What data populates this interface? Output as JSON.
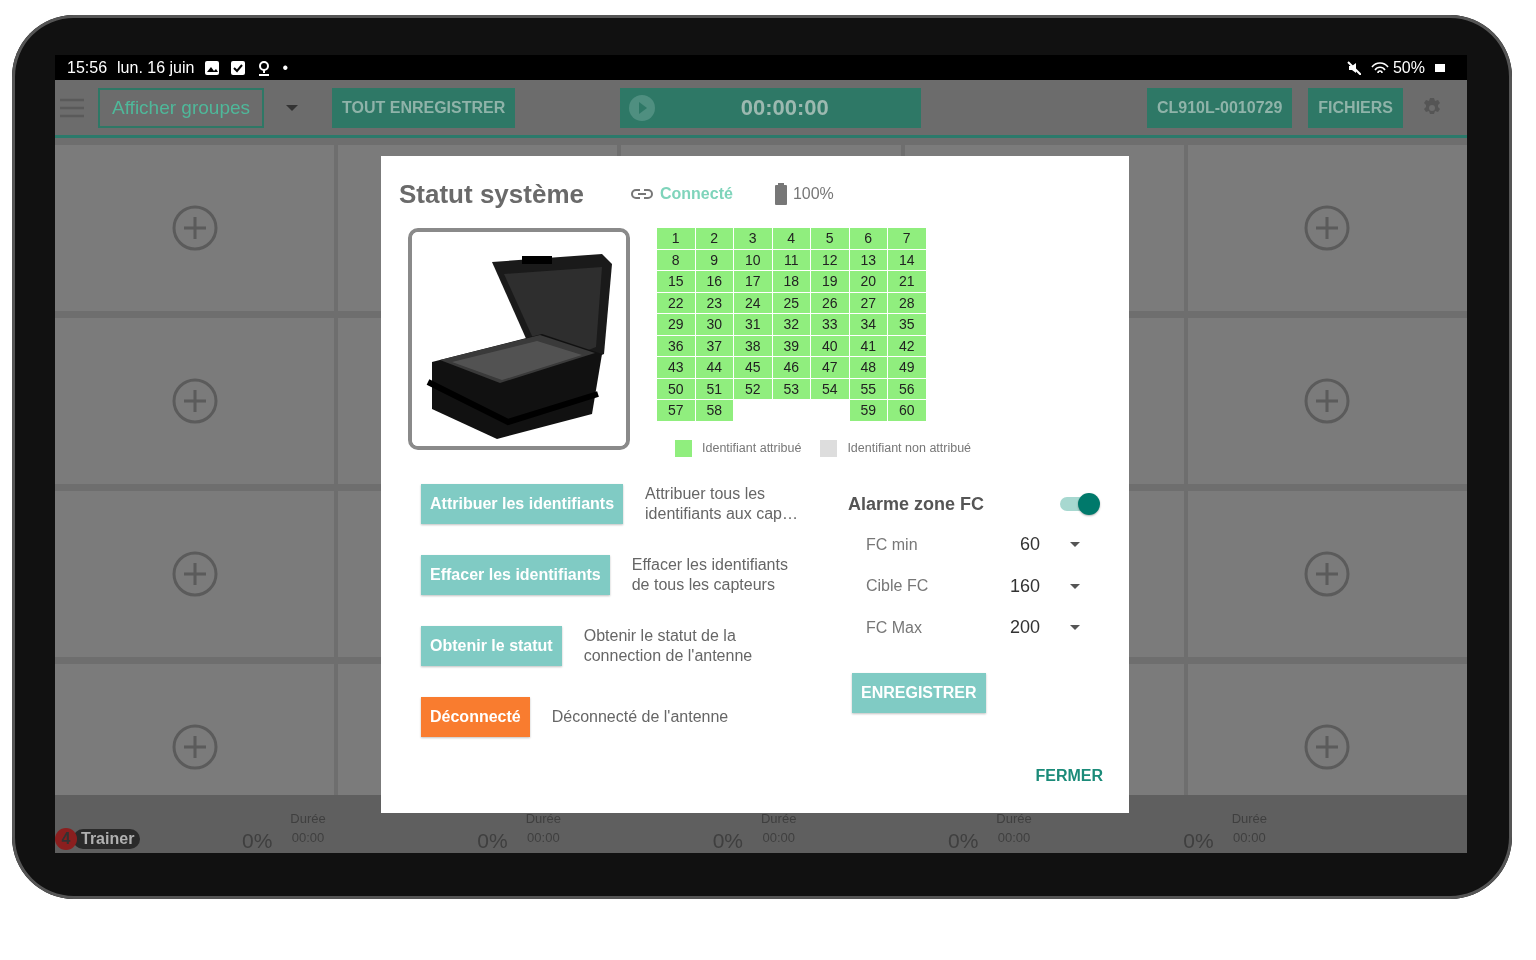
{
  "status_bar": {
    "time": "15:56",
    "date": "lun. 16 juin",
    "dot": "•",
    "battery": "50%"
  },
  "app_bar": {
    "group_field": "Afficher groupes",
    "record_all": "TOUT ENREGISTRER",
    "timer": "00:00:00",
    "device": "CL910L-0010729",
    "files": "FICHIERS"
  },
  "footer": {
    "logo_badge": "4",
    "logo_text": "Trainer",
    "cells": [
      {
        "kind": "logo",
        "percent": "0%"
      },
      {
        "kind": "duration",
        "label": "Durée",
        "value": "00:00",
        "percent": "0%"
      },
      {
        "kind": "duration",
        "label": "Durée",
        "value": "00:00",
        "percent": "0%"
      },
      {
        "kind": "duration",
        "label": "Durée",
        "value": "00:00",
        "percent": "0%"
      },
      {
        "kind": "duration",
        "label": "Durée",
        "value": "00:00",
        "percent": "0%"
      },
      {
        "kind": "duration",
        "label": "Durée",
        "value": "00:00"
      }
    ]
  },
  "dialog": {
    "title": "Statut système",
    "connection": "Connecté",
    "battery": "100%",
    "id_grid": {
      "cells": [
        {
          "kind": "id",
          "label": "1",
          "assigned": true
        },
        {
          "kind": "id",
          "label": "2",
          "assigned": true
        },
        {
          "kind": "id",
          "label": "3",
          "assigned": true
        },
        {
          "kind": "id",
          "label": "4",
          "assigned": true
        },
        {
          "kind": "id",
          "label": "5",
          "assigned": true
        },
        {
          "kind": "id",
          "label": "6",
          "assigned": true
        },
        {
          "kind": "id",
          "label": "7",
          "assigned": true
        },
        {
          "kind": "id",
          "label": "8",
          "assigned": true
        },
        {
          "kind": "id",
          "label": "9",
          "assigned": true
        },
        {
          "kind": "id",
          "label": "10",
          "assigned": true
        },
        {
          "kind": "id",
          "label": "11",
          "assigned": true
        },
        {
          "kind": "id",
          "label": "12",
          "assigned": true
        },
        {
          "kind": "id",
          "label": "13",
          "assigned": true
        },
        {
          "kind": "id",
          "label": "14",
          "assigned": true
        },
        {
          "kind": "id",
          "label": "15",
          "assigned": true
        },
        {
          "kind": "id",
          "label": "16",
          "assigned": true
        },
        {
          "kind": "id",
          "label": "17",
          "assigned": true
        },
        {
          "kind": "id",
          "label": "18",
          "assigned": true
        },
        {
          "kind": "id",
          "label": "19",
          "assigned": true
        },
        {
          "kind": "id",
          "label": "20",
          "assigned": true
        },
        {
          "kind": "id",
          "label": "21",
          "assigned": true
        },
        {
          "kind": "id",
          "label": "22",
          "assigned": true
        },
        {
          "kind": "id",
          "label": "23",
          "assigned": true
        },
        {
          "kind": "id",
          "label": "24",
          "assigned": true
        },
        {
          "kind": "id",
          "label": "25",
          "assigned": true
        },
        {
          "kind": "id",
          "label": "26",
          "assigned": true
        },
        {
          "kind": "id",
          "label": "27",
          "assigned": true
        },
        {
          "kind": "id",
          "label": "28",
          "assigned": true
        },
        {
          "kind": "id",
          "label": "29",
          "assigned": true
        },
        {
          "kind": "id",
          "label": "30",
          "assigned": true
        },
        {
          "kind": "id",
          "label": "31",
          "assigned": true
        },
        {
          "kind": "id",
          "label": "32",
          "assigned": true
        },
        {
          "kind": "id",
          "label": "33",
          "assigned": true
        },
        {
          "kind": "id",
          "label": "34",
          "assigned": true
        },
        {
          "kind": "id",
          "label": "35",
          "assigned": true
        },
        {
          "kind": "id",
          "label": "36",
          "assigned": true
        },
        {
          "kind": "id",
          "label": "37",
          "assigned": true
        },
        {
          "kind": "id",
          "label": "38",
          "assigned": true
        },
        {
          "kind": "id",
          "label": "39",
          "assigned": true
        },
        {
          "kind": "id",
          "label": "40",
          "assigned": true
        },
        {
          "kind": "id",
          "label": "41",
          "assigned": true
        },
        {
          "kind": "id",
          "label": "42",
          "assigned": true
        },
        {
          "kind": "id",
          "label": "43",
          "assigned": true
        },
        {
          "kind": "id",
          "label": "44",
          "assigned": true
        },
        {
          "kind": "id",
          "label": "45",
          "assigned": true
        },
        {
          "kind": "id",
          "label": "46",
          "assigned": true
        },
        {
          "kind": "id",
          "label": "47",
          "assigned": true
        },
        {
          "kind": "id",
          "label": "48",
          "assigned": true
        },
        {
          "kind": "id",
          "label": "49",
          "assigned": true
        },
        {
          "kind": "id",
          "label": "50",
          "assigned": true
        },
        {
          "kind": "id",
          "label": "51",
          "assigned": true
        },
        {
          "kind": "id",
          "label": "52",
          "assigned": true
        },
        {
          "kind": "id",
          "label": "53",
          "assigned": true
        },
        {
          "kind": "id",
          "label": "54",
          "assigned": true
        },
        {
          "kind": "id",
          "label": "55",
          "assigned": true
        },
        {
          "kind": "id",
          "label": "56",
          "assigned": true
        },
        {
          "kind": "id",
          "label": "57",
          "assigned": true
        },
        {
          "kind": "id",
          "label": "58",
          "assigned": true
        },
        {
          "kind": "blank"
        },
        {
          "kind": "blank"
        },
        {
          "kind": "blank"
        },
        {
          "kind": "id",
          "label": "59",
          "assigned": true
        },
        {
          "kind": "id",
          "label": "60",
          "assigned": true
        }
      ]
    },
    "legend": [
      {
        "label": "Identifiant attribué",
        "color": "#90ee7e"
      },
      {
        "label": "Identifiant non attribué",
        "color": "#dddddd"
      }
    ],
    "actions": [
      {
        "button": "Attribuer les identifiants",
        "description": "Attribuer tous les identifiants aux cap…",
        "kind": "primary"
      },
      {
        "button": "Effacer les identifiants",
        "description": "Effacer les identifiants de tous les capteurs",
        "kind": "primary"
      },
      {
        "button": "Obtenir le statut",
        "description": "Obtenir le statut de la connection de l'antenne",
        "kind": "primary"
      },
      {
        "button": "Déconnecté",
        "description": "Déconnecté de l'antenne",
        "kind": "warning"
      }
    ],
    "alarm": {
      "label": "Alarme zone FC",
      "on": true
    },
    "settings": [
      {
        "label": "FC min",
        "value": "60"
      },
      {
        "label": "Cible FC",
        "value": "160"
      },
      {
        "label": "FC Max",
        "value": "200"
      }
    ],
    "save": "ENREGISTRER",
    "close": "FERMER"
  }
}
